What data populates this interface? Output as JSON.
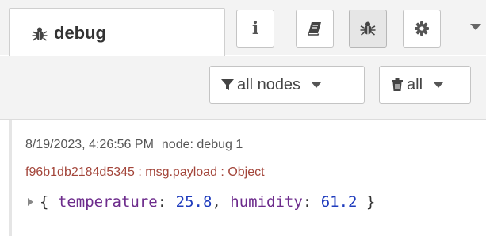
{
  "sidebar_tabs": {
    "active_tab": {
      "icon": "bug-icon",
      "label": "debug"
    },
    "tab_buttons": [
      {
        "icon": "info-icon",
        "label": "i"
      },
      {
        "icon": "book-icon"
      },
      {
        "icon": "bug-icon",
        "selected": true
      },
      {
        "icon": "gear-icon"
      }
    ],
    "menu_icon": "chevron-down-icon"
  },
  "toolbar": {
    "filter_label": "all nodes",
    "filter_icon": "filter-icon",
    "clear_label": "all",
    "clear_icon": "trash-icon"
  },
  "messages": [
    {
      "timestamp": "8/19/2023, 4:26:56 PM",
      "node": "node: debug 1",
      "topic": "f96b1db2184d5345 : msg.payload : Object",
      "payload": {
        "open": "{",
        "k1": "temperature",
        "sep1": ": ",
        "v1": "25.8",
        "comma": ", ",
        "k2": "humidity",
        "sep2": ": ",
        "v2": "61.2",
        "close": " }"
      }
    }
  ],
  "colors": {
    "topic": "#a3453a",
    "payload_key": "#6d2c8c",
    "payload_number": "#1e3bbd",
    "panel_bg": "#f3f3f3"
  }
}
